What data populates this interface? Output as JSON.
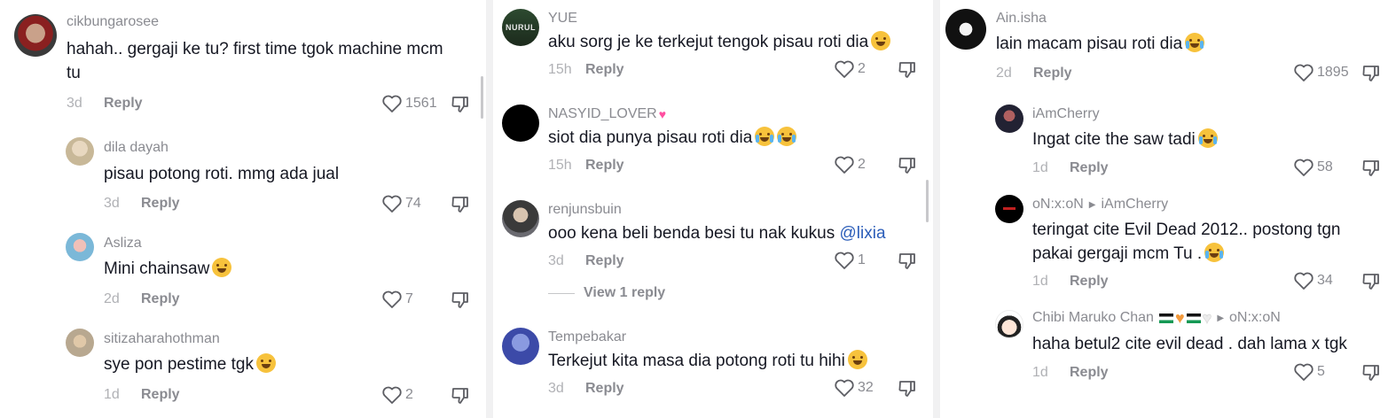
{
  "colors": {
    "username": "#8a8b91",
    "text": "#161823",
    "mention": "#2b5db9",
    "meta": "#b0b1b5"
  },
  "columns": [
    {
      "comments": [
        {
          "user": "cikbungarosee",
          "text": "hahah.. gergaji ke tu? first time tgok machine mcm tu",
          "date": "3d",
          "reply": "Reply",
          "likes": "1561"
        },
        {
          "user": "dila dayah",
          "text": "pisau potong roti. mmg ada jual",
          "date": "3d",
          "reply": "Reply",
          "likes": "74"
        },
        {
          "user": "Asliza",
          "text": "Mini chainsaw",
          "emoji": "grinning-sweat-emoji",
          "date": "2d",
          "reply": "Reply",
          "likes": "7"
        },
        {
          "user": "sitizaharahothman",
          "text": "sye pon pestime tgk",
          "emoji": "grinning-sweat-emoji",
          "date": "1d",
          "reply": "Reply",
          "likes": "2"
        }
      ]
    },
    {
      "comments": [
        {
          "user": "YUE",
          "avatar_text": "NURUL",
          "text": "aku sorg je ke terkejut tengok pisau roti dia",
          "emoji": "laughing-emoji",
          "date": "15h",
          "reply": "Reply",
          "likes": "2"
        },
        {
          "user": "NASYID_LOVER",
          "user_emoji": "two-hearts-emoji",
          "text": "siot dia punya pisau roti dia",
          "emoji": "crying-emoji",
          "date": "15h",
          "reply": "Reply",
          "likes": "2"
        },
        {
          "user": "renjunsbuin",
          "text": "ooo kena beli benda besi tu nak kukus ",
          "mention": "@lixia",
          "date": "3d",
          "reply": "Reply",
          "likes": "1",
          "view_replies": "View 1 reply"
        },
        {
          "user": "Tempebakar",
          "text": "Terkejut kita masa dia potong roti tu hihi",
          "emoji": "grin-emoji",
          "date": "3d",
          "reply": "Reply",
          "likes": "32"
        }
      ]
    },
    {
      "comments": [
        {
          "user": "Ain.isha",
          "text": "lain macam pisau roti dia",
          "emoji": "crying-emoji",
          "date": "2d",
          "reply": "Reply",
          "likes": "1895"
        },
        {
          "user": "iAmCherry",
          "text": "Ingat cite the saw tadi",
          "emoji": "crying-emoji",
          "date": "1d",
          "reply": "Reply",
          "likes": "58"
        },
        {
          "user": "oN:x:oN",
          "reply_to": "iAmCherry",
          "text": "teringat cite Evil Dead 2012.. postong tgn pakai gergaji mcm Tu .",
          "emoji": "crying-emoji",
          "date": "1d",
          "reply": "Reply",
          "likes": "34"
        },
        {
          "user": "Chibi Maruko Chan",
          "user_emoji": "flags-hearts-emoji",
          "reply_to": "oN:x:oN",
          "text": "haha betul2 cite evil dead . dah lama x tgk",
          "date": "1d",
          "reply": "Reply",
          "likes": "5"
        }
      ]
    }
  ]
}
